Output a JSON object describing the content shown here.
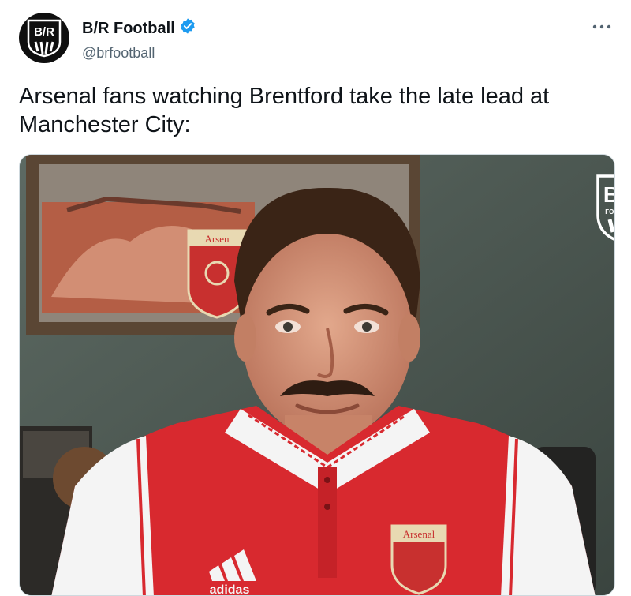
{
  "tweet": {
    "author": {
      "display_name": "B/R Football",
      "handle": "@brfootball",
      "verified": true,
      "avatar_monogram": "B/R"
    },
    "more_icon": "more-horizontal-icon",
    "text": "Arsenal fans watching Brentford take the late lead at Manchester City:"
  },
  "media": {
    "watermark": {
      "monogram": "B/R",
      "subtitle": "FOOTBALL"
    },
    "shirt_badge_text": "Arsenal",
    "brand_text": "adidas",
    "wall_badge_text": "Arsen"
  },
  "colors": {
    "verified": "#1d9bf0",
    "secondary_text": "#536471",
    "arsenal_red": "#d8292f"
  }
}
